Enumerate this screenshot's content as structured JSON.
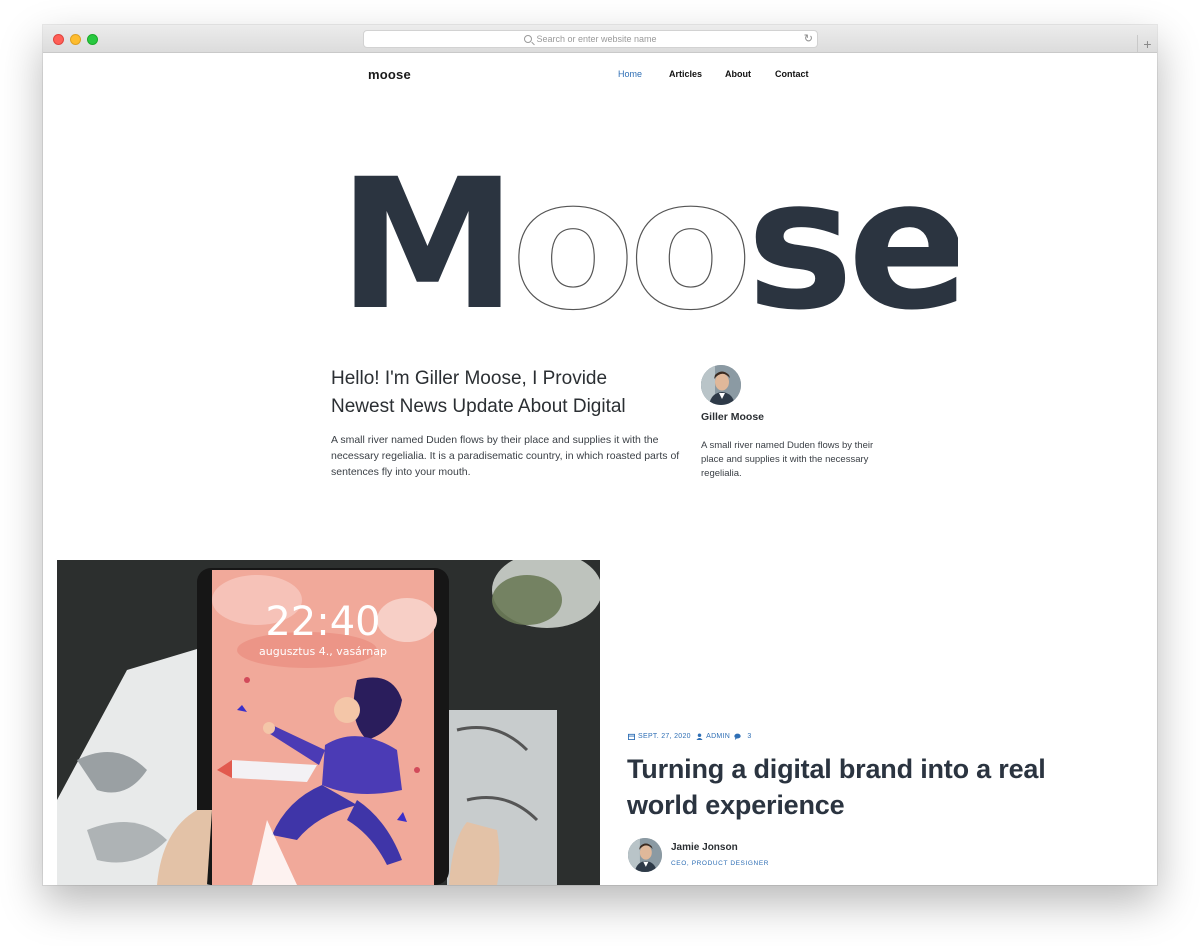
{
  "browser": {
    "address_placeholder": "Search or enter website name"
  },
  "site": {
    "logo": "moose",
    "nav": [
      {
        "label": "Home",
        "active": true
      },
      {
        "label": "Articles",
        "active": false
      },
      {
        "label": "About",
        "active": false
      },
      {
        "label": "Contact",
        "active": false
      }
    ],
    "hero_title": "Moose"
  },
  "intro": {
    "heading_line1": "Hello! I'm Giller Moose, I Provide",
    "heading_line2": "Newest News Update About Digital",
    "text": "A small river named Duden flows by their place and supplies it with the necessary regelialia. It is a paradisematic country, in which roasted parts of sentences fly into your mouth."
  },
  "author": {
    "name": "Giller Moose",
    "bio": "A small river named Duden flows by their place and supplies it with the necessary regelialia."
  },
  "post": {
    "date": "SEPT. 27, 2020",
    "author_meta": "ADMIN",
    "comments": "3",
    "title": "Turning a digital brand into a real world experience",
    "author_name": "Jamie Jonson",
    "author_role": "CEO, PRODUCT DESIGNER",
    "phone_time": "22:40",
    "phone_date": "augusztus 4., vasárnap"
  },
  "colors": {
    "accent": "#2f6fb5",
    "dark": "#2b3440"
  }
}
